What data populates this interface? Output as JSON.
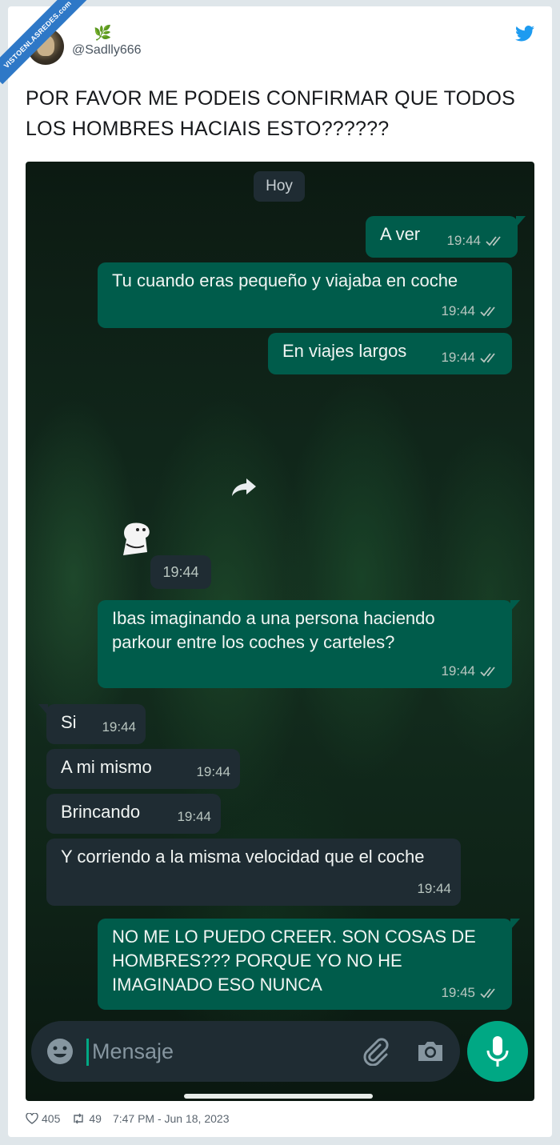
{
  "watermark": "VISTOENLASREDES.com",
  "tweet": {
    "handle": "@Sadlly666",
    "leaf_emoji": "🌿",
    "text": "POR FAVOR ME PODEIS CONFIRMAR QUE TODOS LOS HOMBRES HACIAIS ESTO??????",
    "likes": "405",
    "retweets": "49",
    "timestamp": "7:47 PM - Jun 18, 2023"
  },
  "chat": {
    "date_label": "Hoy",
    "messages": [
      {
        "dir": "out",
        "text": "A ver",
        "time": "19:44"
      },
      {
        "dir": "out",
        "text": "Tu cuando eras pequeño y viajaba en coche",
        "time": "19:44"
      },
      {
        "dir": "out",
        "text": "En viajes largos",
        "time": "19:44"
      },
      {
        "dir": "in",
        "type": "sticker",
        "time": "19:44"
      },
      {
        "dir": "out",
        "text": "Ibas imaginando a una persona haciendo parkour entre los coches y carteles?",
        "time": "19:44"
      },
      {
        "dir": "in",
        "text": "Si",
        "time": "19:44"
      },
      {
        "dir": "in",
        "text": "A mi mismo",
        "time": "19:44"
      },
      {
        "dir": "in",
        "text": "Brincando",
        "time": "19:44"
      },
      {
        "dir": "in",
        "text": "Y corriendo a la misma velocidad que el coche",
        "time": "19:44"
      },
      {
        "dir": "out",
        "text": "NO ME LO PUEDO CREER. SON COSAS DE HOMBRES??? PORQUE YO NO HE IMAGINADO ESO NUNCA",
        "time": "19:45"
      }
    ],
    "input_placeholder": "Mensaje"
  },
  "colors": {
    "outgoing_bubble": "#005c4b",
    "incoming_bubble": "#1f2c33",
    "accent_green": "#00a884",
    "twitter_blue": "#1d9bf0"
  },
  "icons": [
    "twitter-bird-icon",
    "double-check-icon",
    "forward-icon",
    "emoji-icon",
    "paperclip-icon",
    "camera-icon",
    "microphone-icon",
    "heart-icon",
    "retweet-icon"
  ]
}
